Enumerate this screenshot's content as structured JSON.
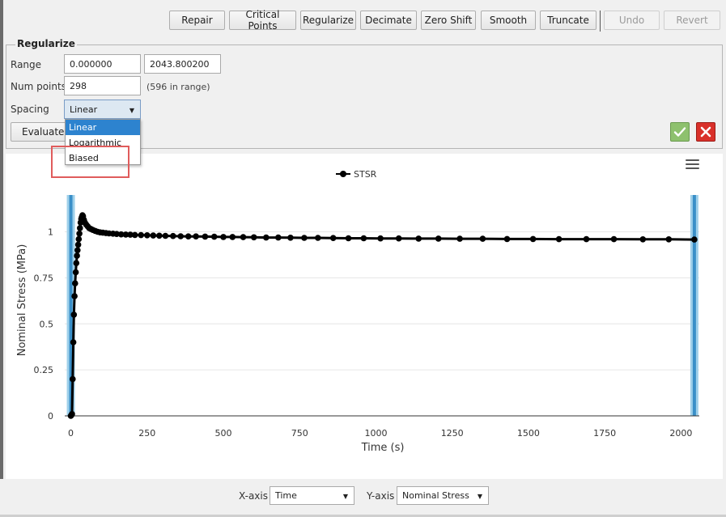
{
  "toolbar": {
    "buttons": [
      {
        "label": "Repair",
        "enabled": true
      },
      {
        "label": "Critical Points",
        "enabled": true
      },
      {
        "label": "Regularize",
        "enabled": true
      },
      {
        "label": "Decimate",
        "enabled": true
      },
      {
        "label": "Zero Shift",
        "enabled": true
      },
      {
        "label": "Smooth",
        "enabled": true
      },
      {
        "label": "Truncate",
        "enabled": true
      },
      {
        "label": "Undo",
        "enabled": false
      },
      {
        "label": "Revert",
        "enabled": false
      }
    ]
  },
  "panel": {
    "title": "Regularize",
    "range_label": "Range",
    "range_min": "0.000000",
    "range_max": "2043.800200",
    "num_points_label": "Num points",
    "num_points": "298",
    "num_points_note": "(596 in range)",
    "spacing_label": "Spacing",
    "spacing_value": "Linear",
    "spacing_options": [
      "Linear",
      "Logarithmic",
      "Biased"
    ],
    "evaluate_label": "Evaluate",
    "accept_icon": "checkmark-icon",
    "cancel_icon": "close-x-icon",
    "accept_color": "#8ec16e",
    "cancel_color": "#d9302a"
  },
  "chart_menu_icon": "hamburger-menu-icon",
  "chart_data": {
    "type": "line",
    "legend": "STSR",
    "legend_position": "top-center",
    "xlabel": "Time (s)",
    "ylabel": "Nominal Stress (MPa)",
    "xlim": [
      -20,
      2060
    ],
    "ylim": [
      0,
      1.2
    ],
    "xticks": [
      "0",
      "250",
      "500",
      "750",
      "1000",
      "1250",
      "1500",
      "1750",
      "2000"
    ],
    "yticks": [
      "0",
      "0.25",
      "0.5",
      "0.75",
      "1"
    ],
    "grid_horizontal": true,
    "range_markers": [
      0,
      2043.8
    ],
    "series": [
      {
        "name": "STSR",
        "color": "#000000",
        "x": [
          0,
          2,
          4,
          6,
          8,
          10,
          12,
          14,
          16,
          18,
          20,
          22,
          24,
          26,
          28,
          30,
          32,
          34,
          36,
          38,
          40,
          43,
          46,
          50,
          55,
          60,
          66,
          72,
          80,
          88,
          96,
          105,
          115,
          125,
          138,
          150,
          165,
          180,
          195,
          210,
          230,
          250,
          270,
          290,
          310,
          335,
          360,
          385,
          410,
          440,
          470,
          500,
          530,
          565,
          600,
          640,
          680,
          720,
          765,
          810,
          860,
          910,
          960,
          1015,
          1075,
          1140,
          1205,
          1275,
          1350,
          1430,
          1515,
          1600,
          1690,
          1780,
          1875,
          1960,
          2043.8
        ],
        "y": [
          0,
          0.005,
          0.01,
          0.2,
          0.4,
          0.55,
          0.65,
          0.72,
          0.78,
          0.83,
          0.87,
          0.9,
          0.93,
          0.96,
          0.99,
          1.02,
          1.05,
          1.07,
          1.08,
          1.09,
          1.085,
          1.065,
          1.05,
          1.04,
          1.03,
          1.02,
          1.015,
          1.01,
          1.005,
          1.0,
          0.997,
          0.995,
          0.993,
          0.991,
          0.99,
          0.988,
          0.986,
          0.985,
          0.984,
          0.983,
          0.982,
          0.981,
          0.98,
          0.979,
          0.978,
          0.977,
          0.976,
          0.975,
          0.975,
          0.974,
          0.973,
          0.972,
          0.972,
          0.971,
          0.97,
          0.969,
          0.969,
          0.968,
          0.967,
          0.967,
          0.966,
          0.965,
          0.965,
          0.964,
          0.964,
          0.963,
          0.963,
          0.962,
          0.962,
          0.961,
          0.961,
          0.96,
          0.96,
          0.96,
          0.959,
          0.959,
          0.958
        ]
      }
    ]
  },
  "bottom": {
    "xaxis_label": "X-axis",
    "xaxis_value": "Time",
    "yaxis_label": "Y-axis",
    "yaxis_value": "Nominal Stress"
  }
}
